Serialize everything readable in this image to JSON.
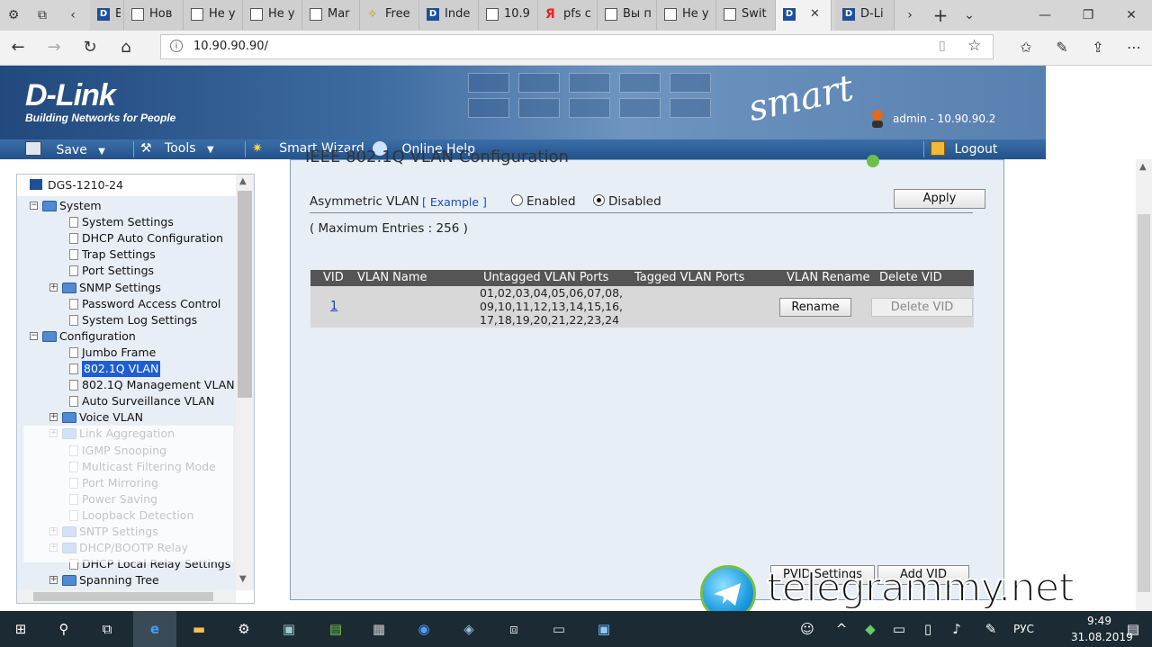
{
  "browser": {
    "tabs": [
      {
        "label": "Вы п",
        "icon": "dlink"
      },
      {
        "label": "Нов",
        "icon": "page"
      },
      {
        "label": "Не у",
        "icon": "page"
      },
      {
        "label": "Не у",
        "icon": "page"
      },
      {
        "label": "Mar",
        "icon": "page"
      },
      {
        "label": "Free",
        "icon": "star"
      },
      {
        "label": "Inde",
        "icon": "dlink"
      },
      {
        "label": "10.9",
        "icon": "page"
      },
      {
        "label": "pfs с",
        "icon": "ya"
      },
      {
        "label": "Вы п",
        "icon": "page"
      },
      {
        "label": "Не у",
        "icon": "page"
      },
      {
        "label": "Swit",
        "icon": "page"
      },
      {
        "label": "",
        "icon": "dlink"
      },
      {
        "label": "D-Li",
        "icon": "dlink"
      }
    ],
    "url": "10.90.90.90/"
  },
  "header": {
    "brand": "D-Link",
    "tagline": "Building Networks for People",
    "product": "smart",
    "user": "admin - 10.90.90.2"
  },
  "menu": {
    "save": "Save",
    "tools": "Tools",
    "wizard": "Smart Wizard",
    "help": "Online Help",
    "logout": "Logout"
  },
  "tree": {
    "root": "DGS-1210-24",
    "items": [
      {
        "label": "System",
        "type": "folder",
        "level": 1,
        "expander": "−"
      },
      {
        "label": "System Settings",
        "type": "leaf",
        "level": 2
      },
      {
        "label": "DHCP Auto Configuration",
        "type": "leaf",
        "level": 2
      },
      {
        "label": "Trap Settings",
        "type": "leaf",
        "level": 2
      },
      {
        "label": "Port Settings",
        "type": "leaf",
        "level": 2
      },
      {
        "label": "SNMP Settings",
        "type": "folder",
        "level": 2,
        "expander": "+"
      },
      {
        "label": "Password Access Control",
        "type": "leaf",
        "level": 2
      },
      {
        "label": "System Log Settings",
        "type": "leaf",
        "level": 2
      },
      {
        "label": "Configuration",
        "type": "folder",
        "level": 1,
        "expander": "−"
      },
      {
        "label": "Jumbo Frame",
        "type": "leaf",
        "level": 2
      },
      {
        "label": "802.1Q VLAN",
        "type": "leaf",
        "level": 2,
        "selected": true
      },
      {
        "label": "802.1Q Management VLAN",
        "type": "leaf",
        "level": 2
      },
      {
        "label": "Auto Surveillance VLAN",
        "type": "leaf",
        "level": 2
      },
      {
        "label": "Voice VLAN",
        "type": "folder",
        "level": 2,
        "expander": "+"
      },
      {
        "label": "Link Aggregation",
        "type": "folder",
        "level": 2,
        "expander": "+"
      },
      {
        "label": "IGMP Snooping",
        "type": "leaf",
        "level": 2
      },
      {
        "label": "Multicast Filtering Mode",
        "type": "leaf",
        "level": 2
      },
      {
        "label": "Port Mirroring",
        "type": "leaf",
        "level": 2
      },
      {
        "label": "Power Saving",
        "type": "leaf",
        "level": 2
      },
      {
        "label": "Loopback Detection",
        "type": "leaf",
        "level": 2
      },
      {
        "label": "SNTP Settings",
        "type": "folder",
        "level": 2,
        "expander": "+"
      },
      {
        "label": "DHCP/BOOTP Relay",
        "type": "folder",
        "level": 2,
        "expander": "+"
      },
      {
        "label": "DHCP Local Relay Settings",
        "type": "leaf",
        "level": 2
      },
      {
        "label": "Spanning Tree",
        "type": "folder",
        "level": 2,
        "expander": "+"
      }
    ]
  },
  "main": {
    "title": "IEEE 802.1Q VLAN Configuration",
    "asym_label": "Asymmetric VLAN",
    "example_link": "[ Example ]",
    "enabled": "Enabled",
    "disabled": "Disabled",
    "asym_selected": "Disabled",
    "apply": "Apply",
    "max_entries": "( Maximum Entries : 256 )",
    "table": {
      "headers": [
        "VID",
        "VLAN Name",
        "Untagged VLAN Ports",
        "Tagged VLAN Ports",
        "VLAN Rename",
        "Delete VID"
      ],
      "rows": [
        {
          "vid": "1",
          "name": "",
          "untagged_lines": [
            "01,02,03,04,05,06,07,08,",
            "09,10,11,12,13,14,15,16,",
            "17,18,19,20,21,22,23,24"
          ],
          "tagged": "",
          "rename": "Rename",
          "delete": "Delete VID"
        }
      ]
    },
    "pvid_button": "PVID Settings",
    "add_vid_button": "Add VID"
  },
  "watermark_text": "telegrammy.net",
  "taskbar": {
    "lang": "РУС",
    "time": "9:49",
    "date": "31.08.2019"
  },
  "colors": {
    "banner": "#3c6aa0",
    "menubar": "#2b5c94",
    "panel": "#e8eef6",
    "table_head": "#555555",
    "selected": "#1f5ed1"
  }
}
